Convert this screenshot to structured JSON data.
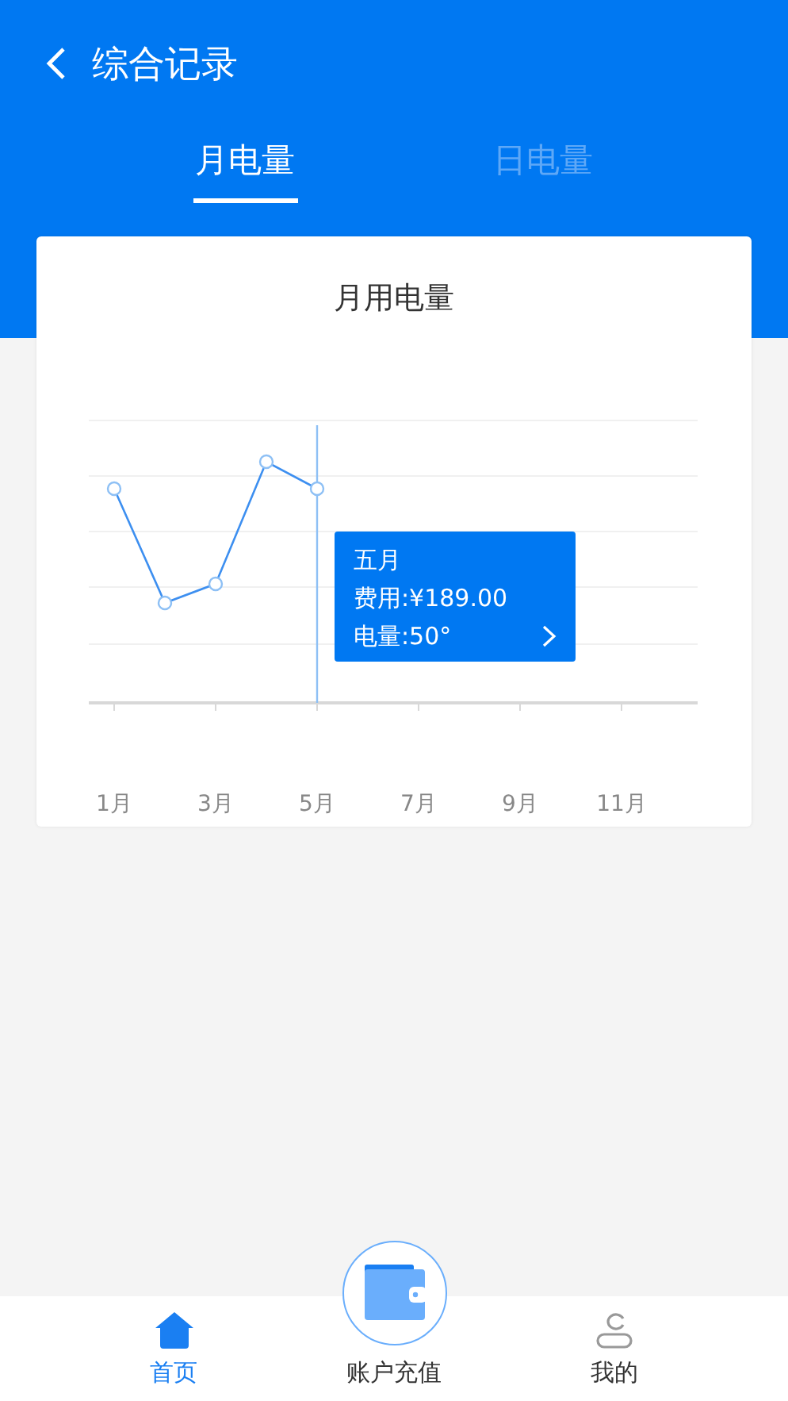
{
  "header": {
    "title": "综合记录"
  },
  "tabs": [
    {
      "label": "月电量",
      "selected": true
    },
    {
      "label": "日电量",
      "selected": false
    }
  ],
  "card": {
    "title": "月用电量",
    "x_labels": [
      "1月",
      "3月",
      "5月",
      "7月",
      "9月",
      "11月"
    ],
    "tooltip": {
      "title": "五月",
      "lines": [
        "费用:¥189.00"
      ],
      "last_line": "电量:50°"
    }
  },
  "nav": [
    {
      "label": "首页",
      "kind": "home",
      "selected": true
    },
    {
      "label": "账户充值",
      "kind": "wallet",
      "selected": false
    },
    {
      "label": "我的",
      "kind": "user",
      "selected": false
    }
  ]
}
